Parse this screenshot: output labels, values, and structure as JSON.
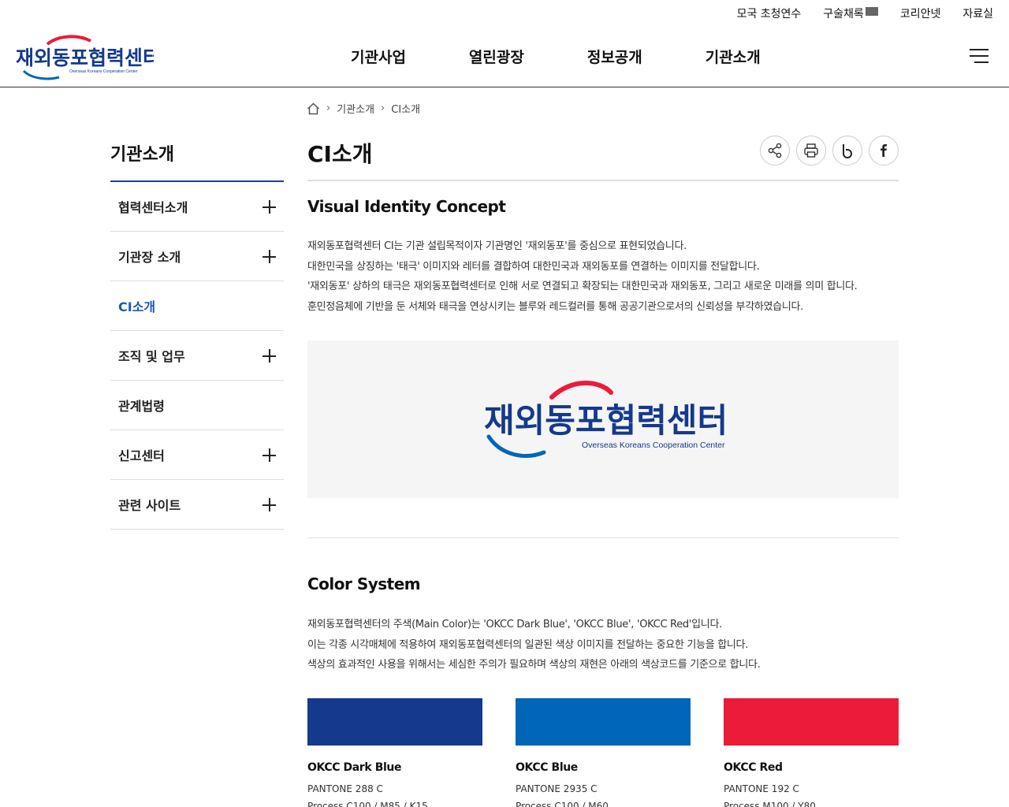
{
  "utility": {
    "items": [
      "모국 초청연수",
      "구술채록",
      "코리안넷",
      "자료실"
    ]
  },
  "logo": {
    "korean": "재외동포협력센터",
    "english": "Overseas Koreans Cooperation Center"
  },
  "gnb": [
    "기관사업",
    "열린광장",
    "정보공개",
    "기관소개"
  ],
  "breadcrumb": [
    "기관소개",
    "CI소개"
  ],
  "sidebar": {
    "title": "기관소개",
    "items": [
      {
        "label": "협력센터소개",
        "expandable": true
      },
      {
        "label": "기관장 소개",
        "expandable": true
      },
      {
        "label": "CI소개",
        "expandable": false,
        "active": true
      },
      {
        "label": "조직 및 업무",
        "expandable": true
      },
      {
        "label": "관계법령",
        "expandable": false
      },
      {
        "label": "신고센터",
        "expandable": true
      },
      {
        "label": "관련 사이트",
        "expandable": true
      }
    ]
  },
  "page": {
    "title": "CI소개",
    "tools": [
      "share-icon",
      "print-icon",
      "blog-icon",
      "facebook-icon"
    ],
    "vi": {
      "heading": "Visual Identity Concept",
      "lines": [
        "재외동포협력센터 CI는 기관 설립목적이자 기관명인 '재외동포'를 중심으로 표현되었습니다.",
        "대한민국을 상징하는 '태극' 이미지와 레터를 결합하여 대한민국과 재외동포를 연결하는 이미지를 전달합니다.",
        "'재외동포' 상하의 태극은 재외동포협력센터로 인해 서로 연결되고 확장되는 대한민국과 재외동포, 그리고 새로운 미래를 의미 합니다.",
        "훈민정음체에 기반을 둔 서체와 태극을 연상시키는 블루와 레드컬러를 통해 공공기관으로서의 신뢰성을 부각하였습니다."
      ]
    },
    "color": {
      "heading": "Color System",
      "lines": [
        "재외동포협력센터의 주색(Main Color)는 'OKCC Dark Blue', 'OKCC Blue', 'OKCC Red'입니다.",
        "이는 각종 시각매체에 적용하여 재외동포협력센터의 일관된 색상 이미지를 전달하는 중요한 기능을 합니다.",
        "색상의 효과적인 사용을 위해서는 세심한 주의가 필요하며 색상의 재현은 아래의 색상코드를 기준으로 합니다."
      ],
      "swatches": [
        {
          "name": "OKCC Dark Blue",
          "pantone": "PANTONE 288 C",
          "process": "Process C100 / M85 / K15",
          "hex": "#15398c"
        },
        {
          "name": "OKCC Blue",
          "pantone": "PANTONE 2935 C",
          "process": "Process C100 / M60",
          "hex": "#0066b8"
        },
        {
          "name": "OKCC Red",
          "pantone": "PANTONE 192 C",
          "process": "Process M100 / Y80",
          "hex": "#ec1b3a"
        }
      ]
    }
  }
}
